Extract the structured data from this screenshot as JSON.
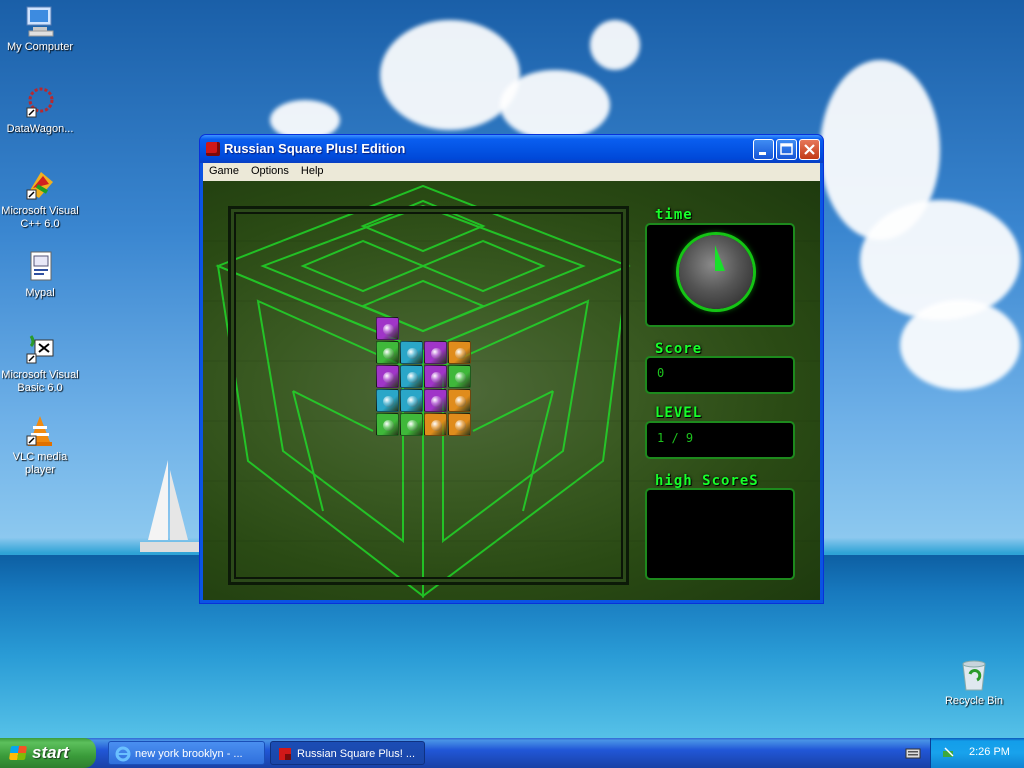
{
  "desktop": {
    "icons": [
      {
        "label": "My Computer"
      },
      {
        "label": "DataWagon..."
      },
      {
        "label": "Microsoft Visual C++ 6.0"
      },
      {
        "label": "Mypal"
      },
      {
        "label": "Microsoft Visual Basic 6.0"
      },
      {
        "label": "VLC media player"
      },
      {
        "label": "Recycle Bin"
      }
    ]
  },
  "window": {
    "title": "Russian Square Plus! Edition",
    "menu": [
      "Game",
      "Options",
      "Help"
    ],
    "panels": {
      "time_label": "time",
      "score_label": "Score",
      "score_value": "0",
      "level_label": "LEVEL",
      "level_value": "1 / 9",
      "highscores_label": "high ScoreS"
    },
    "block_colors": {
      "purple": "#a035c8",
      "cyan": "#2aa6c8",
      "green": "#3fb83a",
      "orange": "#e08c1c"
    },
    "blocks": [
      [
        "purple",
        null,
        null,
        null
      ],
      [
        "green",
        "cyan",
        "purple",
        "orange"
      ],
      [
        "purple",
        "cyan",
        "purple",
        "green"
      ],
      [
        "cyan",
        "cyan",
        "purple",
        "orange"
      ],
      [
        "green",
        "green",
        "orange",
        "orange"
      ]
    ]
  },
  "taskbar": {
    "start_label": "start",
    "tasks": [
      {
        "label": "new york brooklyn - ..."
      },
      {
        "label": "Russian Square Plus! ..."
      }
    ],
    "clock": "2:26 PM"
  }
}
